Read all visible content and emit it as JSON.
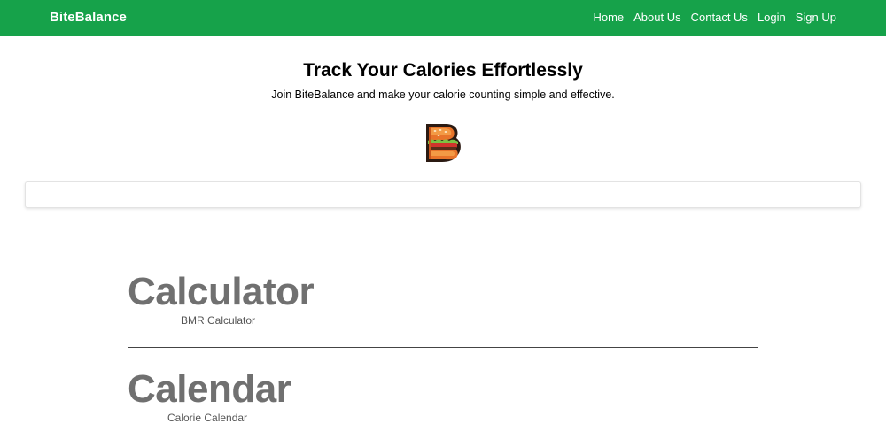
{
  "navbar": {
    "brand": "BiteBalance",
    "links": [
      {
        "label": "Home"
      },
      {
        "label": "About Us"
      },
      {
        "label": "Contact Us"
      },
      {
        "label": "Login"
      },
      {
        "label": "Sign Up"
      }
    ],
    "background_color": "#16a24a"
  },
  "hero": {
    "title": "Track Your Calories Effortlessly",
    "subtitle": "Join BiteBalance and make your calorie counting simple and effective.",
    "logo_icon": "burger-b-logo-icon"
  },
  "sections": [
    {
      "heading": "Calculator",
      "link": "BMR Calculator"
    },
    {
      "heading": "Calendar",
      "link": "Calorie Calendar"
    }
  ]
}
